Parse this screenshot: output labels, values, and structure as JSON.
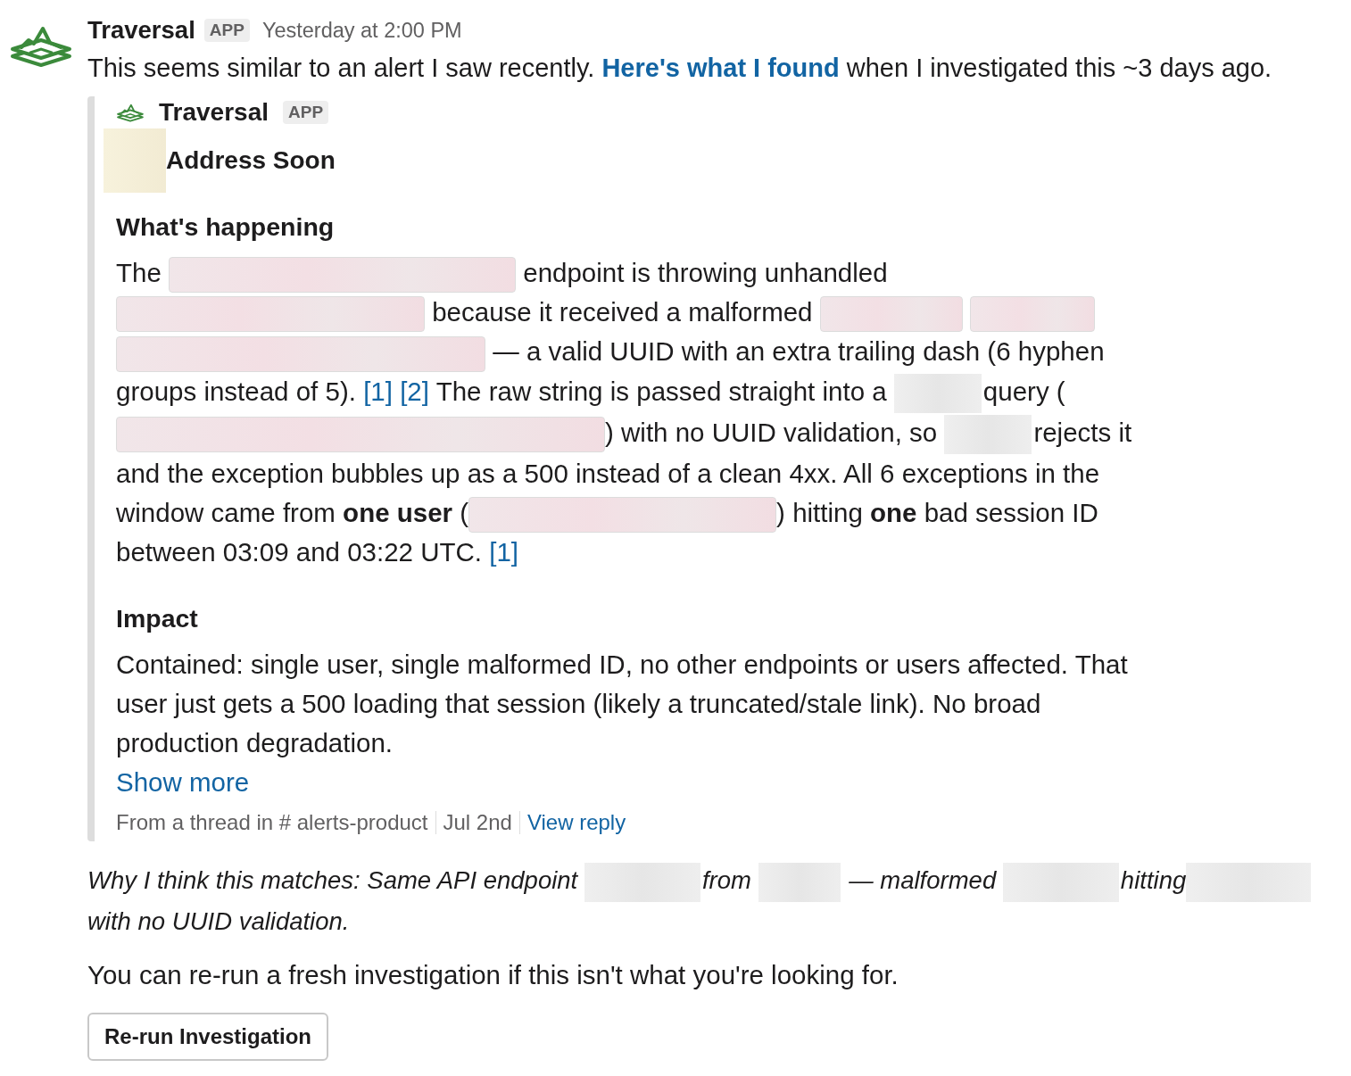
{
  "message": {
    "sender": "Traversal",
    "badge": "APP",
    "timestamp": "Yesterday at 2:00 PM",
    "text": [
      {
        "kind": "text",
        "text": "This seems similar to an alert I saw recently. "
      },
      {
        "kind": "link",
        "text": "Here's what I found"
      },
      {
        "kind": "text",
        "text": " when I investigated this ~3 days ago."
      }
    ]
  },
  "attachment": {
    "app_name": "Traversal",
    "badge": "APP",
    "title": [
      {
        "kind": "redacted_emoji"
      },
      {
        "kind": "text",
        "text": "Address Soon"
      }
    ],
    "sections": [
      {
        "heading": "What's happening",
        "body": [
          {
            "kind": "text",
            "text": "The "
          },
          {
            "kind": "redacted_code"
          },
          {
            "kind": "text",
            "text": " endpoint is throwing unhandled "
          },
          {
            "kind": "redacted_code"
          },
          {
            "kind": "text",
            "text": " because it received a malformed "
          },
          {
            "kind": "redacted_code"
          },
          {
            "kind": "redacted_code"
          },
          {
            "kind": "redacted_code"
          },
          {
            "kind": "text",
            "text": " — a valid UUID with an extra trailing dash (6 hyphen groups instead of 5). "
          },
          {
            "kind": "citation",
            "text": "[1]"
          },
          {
            "kind": "citation",
            "text": "[2]"
          },
          {
            "kind": "text",
            "text": " The raw string is passed straight into a "
          },
          {
            "kind": "redacted_text"
          },
          {
            "kind": "text",
            "text": "query ("
          },
          {
            "kind": "redacted_code"
          },
          {
            "kind": "text",
            "text": ") with no UUID validation, so "
          },
          {
            "kind": "redacted_text"
          },
          {
            "kind": "text",
            "text": "rejects it and the exception bubbles up as a 500 instead of a clean 4xx. All 6 exceptions in the window came from **one user** ("
          },
          {
            "kind": "redacted_code"
          },
          {
            "kind": "text",
            "text": ") hitting **one** bad session ID between 03:09 and 03:22 UTC. "
          },
          {
            "kind": "citation",
            "text": "[1]"
          }
        ]
      },
      {
        "heading": "Impact",
        "body": [
          {
            "kind": "text",
            "text": "Contained: single user, single malformed ID, no other endpoints or users affected. That user just gets a 500 loading that session (likely a truncated/stale link). No broad production degradation."
          }
        ]
      }
    ],
    "show_more": "Show more",
    "footer": {
      "source": "From a thread in # alerts-product",
      "date": "Jul 2nd",
      "link": "View reply"
    }
  },
  "reason": [
    {
      "kind": "text",
      "text": "Why I think this matches: Same API endpoint "
    },
    {
      "kind": "redacted_text"
    },
    {
      "kind": "text",
      "text": "from "
    },
    {
      "kind": "redacted_text"
    },
    {
      "kind": "text",
      "text": " — malformed "
    },
    {
      "kind": "redacted_text"
    },
    {
      "kind": "text",
      "text": "hitting"
    },
    {
      "kind": "redacted_text"
    },
    {
      "kind": "text",
      "text": " with no UUID validation."
    }
  ],
  "note": "You can re-run a fresh investigation if this isn't what you're looking for.",
  "button": "Re-run Investigation"
}
